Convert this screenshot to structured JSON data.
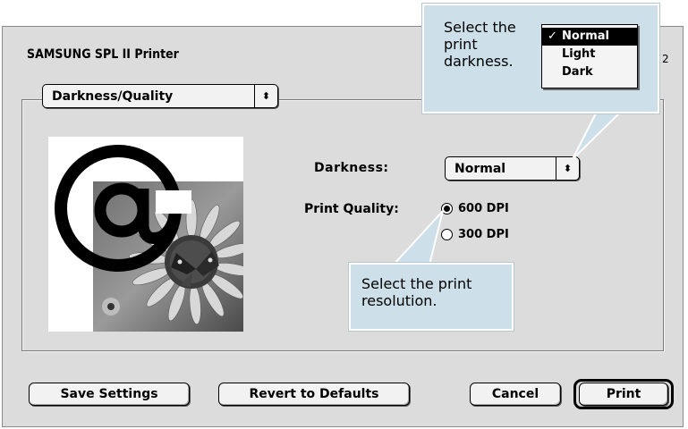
{
  "dialog": {
    "title": "SAMSUNG SPL II Printer",
    "version": "2",
    "panel_popup": {
      "value": "Darkness/Quality",
      "arrow": "⬍"
    }
  },
  "darkness": {
    "label": "Darkness:",
    "value": "Normal",
    "arrow": "⬍",
    "menu_options": [
      "Normal",
      "Light",
      "Dark"
    ],
    "check": "✓"
  },
  "print_quality": {
    "label": "Print Quality:",
    "options": [
      {
        "label": "600 DPI",
        "selected": true
      },
      {
        "label": "300 DPI",
        "selected": false
      }
    ]
  },
  "buttons": {
    "save": "Save Settings",
    "revert": "Revert to Defaults",
    "cancel": "Cancel",
    "print": "Print"
  },
  "callouts": {
    "darkness_tip": "Select the print darkness.",
    "resolution_tip": "Select the print resolution."
  },
  "colors": {
    "dialog_bg": "#dcdcdc",
    "callout_bg": "#cddfe9"
  },
  "icons": [
    "at-sign-icon",
    "sunflower-butterfly-image",
    "popup-arrows-icon",
    "checkmark-icon"
  ]
}
